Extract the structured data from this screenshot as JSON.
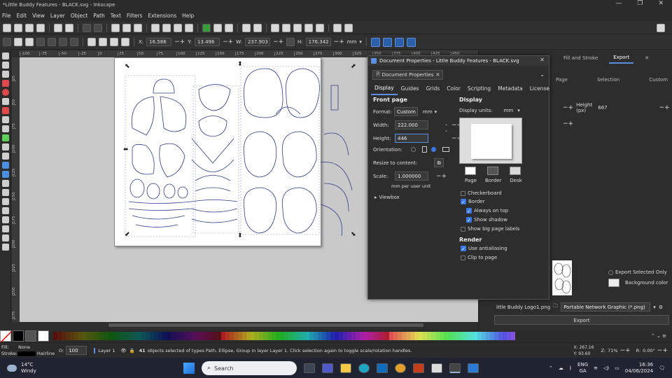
{
  "window": {
    "title": "*Little Buddy Features - BLACK.svg - Inkscape",
    "controls": [
      "—",
      "❐",
      "✕"
    ]
  },
  "menu": [
    "File",
    "Edit",
    "View",
    "Layer",
    "Object",
    "Path",
    "Text",
    "Filters",
    "Extensions",
    "Help"
  ],
  "toolcontrols": {
    "x_label": "X:",
    "x_value": "16.586",
    "y_label": "Y:",
    "y_value": "13.496",
    "w_label": "W:",
    "w_value": "237.903",
    "h_label": "H:",
    "h_value": "176.342",
    "unit": "mm"
  },
  "rulers": {
    "top": [
      "-100",
      "-75",
      "-50",
      "-25",
      "0",
      "25",
      "50",
      "75",
      "100",
      "125",
      "150",
      "175",
      "200",
      "225",
      "250",
      "275",
      "300",
      "325",
      "350",
      "375",
      "400",
      "425",
      "450"
    ],
    "left": [
      "25",
      "50",
      "75",
      "100",
      "125",
      "150",
      "175",
      "200",
      "225",
      "250",
      "275"
    ]
  },
  "dialog": {
    "title": "Document Properties - Little Buddy Features - BLACK.svg",
    "tab": "Document Properties",
    "subtabs": [
      "Display",
      "Guides",
      "Grids",
      "Color",
      "Scripting",
      "Metadata",
      "License"
    ],
    "front_page": {
      "heading": "Front page",
      "format_label": "Format:",
      "format_value": "Custom",
      "format_unit": "mm",
      "width_label": "Width:",
      "width_value": "222.000",
      "height_label": "Height:",
      "height_value": "446",
      "orientation_label": "Orientation:",
      "resize_label": "Resize to content:",
      "scale_label": "Scale:",
      "scale_value": "1.000000",
      "scale_note": "mm per user unit",
      "viewbox_label": "Viewbox"
    },
    "display": {
      "heading": "Display",
      "units_label": "Display units:",
      "units_value": "mm",
      "swatch_labels": [
        "Page",
        "Border",
        "Desk"
      ],
      "swatch_colors": [
        "#ffffff",
        "#555555",
        "#d8d8d8"
      ],
      "checkboard": "Checkerboard",
      "border": "Border",
      "always_on_top": "Always on top",
      "show_shadow": "Show shadow",
      "big_labels": "Show big page labels"
    },
    "render": {
      "heading": "Render",
      "antialias": "Use antialiasing",
      "clip": "Clip to page"
    }
  },
  "right_panel": {
    "tabs": [
      "Fill and Stroke",
      "Export"
    ],
    "subtabs": [
      "Page",
      "Selection",
      "Custom"
    ],
    "height_label": "Height",
    "height_unit": "(px)",
    "height_value": "667",
    "export_selected": "Export Selected Only",
    "bg_color": "Background color",
    "filename": "ittle Buddy Logo1.png",
    "filetype": "Portable Network Graphic (*.png)",
    "export_button": "Export"
  },
  "status": {
    "fill_label": "Fill:",
    "stroke_label": "Stroke:",
    "fill_value": "None",
    "stroke_value": "Hairline",
    "opacity_label": "O:",
    "opacity_value": "100",
    "layer": "Layer 1",
    "message_count": "41",
    "message": "objects selected of types Path, Ellipse, Group in layer Layer 1. Click selection again to toggle scale/rotation handles.",
    "x": "X: 267.16",
    "y": "Y: 93.60",
    "zoom_label": "Z:",
    "zoom": "71%",
    "rotation_label": "R:",
    "rotation": "0.00°"
  },
  "taskbar": {
    "weather_temp": "14°C",
    "weather_desc": "Windy",
    "search_placeholder": "Search",
    "lang1": "ENG",
    "lang2": "GA",
    "time": "16:36",
    "date": "04/06/2024"
  }
}
